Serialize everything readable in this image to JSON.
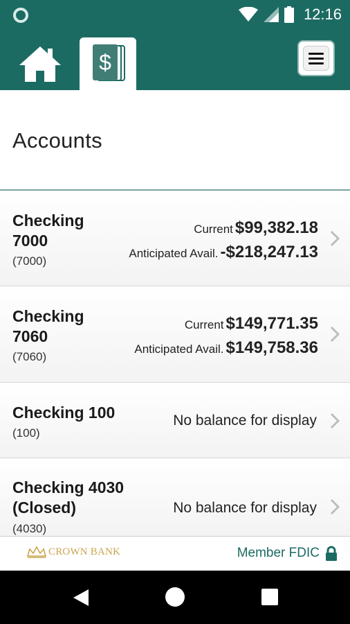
{
  "status_bar": {
    "time": "12:16"
  },
  "header": {
    "home_label": "Home",
    "accounts_label": "Accounts",
    "menu_label": "Menu"
  },
  "page": {
    "title": "Accounts"
  },
  "accounts": [
    {
      "name_line1": "Checking",
      "name_line2": "7000",
      "number": "(7000)",
      "current_label": "Current",
      "current_amount": "$99,382.18",
      "anticipated_label": "Anticipated Avail.",
      "anticipated_amount": "-$218,247.13"
    },
    {
      "name_line1": "Checking",
      "name_line2": "7060",
      "number": "(7060)",
      "current_label": "Current",
      "current_amount": "$149,771.35",
      "anticipated_label": "Anticipated Avail.",
      "anticipated_amount": "$149,758.36"
    },
    {
      "name_line1": "Checking 100",
      "number": "(100)",
      "no_balance": "No balance for display"
    },
    {
      "name_line1": "Checking 4030",
      "name_line2": "(Closed)",
      "number": "(4030)",
      "no_balance": "No balance for display"
    }
  ],
  "footer": {
    "brand_name": "CROWN BANK",
    "fdic_text": "Member FDIC"
  },
  "colors": {
    "brand_teal": "#1c6b63",
    "brand_gold": "#c9a54e"
  },
  "icons": {
    "home": "home-icon",
    "accounts": "dollar-cards-icon",
    "menu": "hamburger-icon",
    "chevron": "chevron-right-icon",
    "lock": "lock-icon",
    "wifi": "wifi-icon",
    "signal": "signal-icon",
    "battery": "battery-icon"
  }
}
